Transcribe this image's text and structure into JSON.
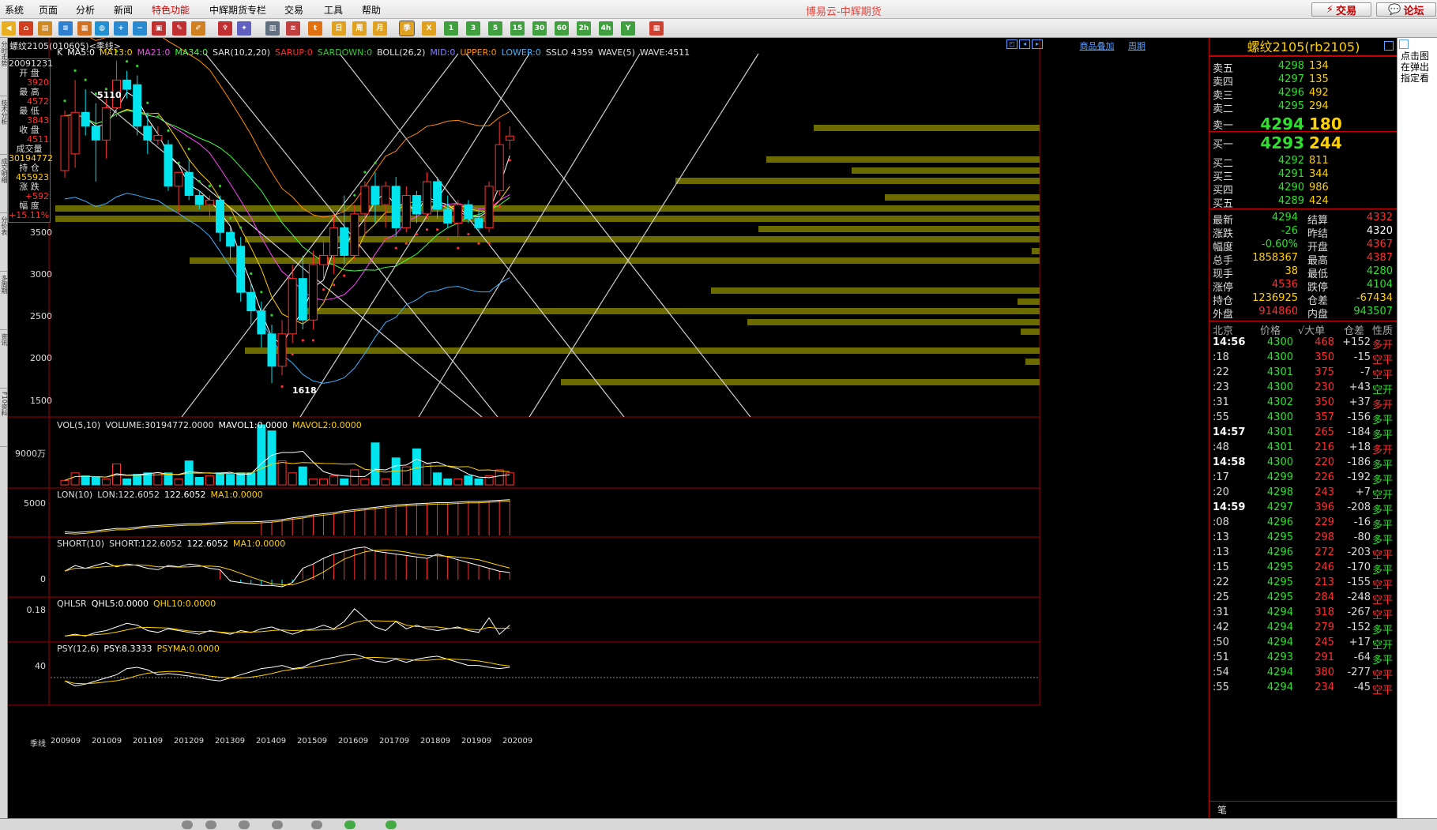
{
  "menu": {
    "items": [
      {
        "label": "系统",
        "special": false
      },
      {
        "label": "页面",
        "special": false
      },
      {
        "label": "分析",
        "special": false
      },
      {
        "label": "新闻",
        "special": false
      },
      {
        "label": "特色功能",
        "special": true
      },
      {
        "label": "中辉期货专栏",
        "special": false
      },
      {
        "label": "交易",
        "special": false
      },
      {
        "label": "工具",
        "special": false
      },
      {
        "label": "帮助",
        "special": false
      }
    ],
    "app_title": "博易云-中辉期货",
    "trade_button": "交易",
    "forum_button": "论坛"
  },
  "toolbar": {
    "period_labels": [
      "日",
      "周",
      "月",
      "季",
      "X",
      "1",
      "3",
      "5",
      "15",
      "30",
      "60",
      "2h",
      "4h",
      "Y"
    ]
  },
  "sidebar": {
    "tabs": [
      "分时走势",
      "技术分析",
      "成交明细",
      "分价表",
      "多周期",
      "资讯",
      "F10资料"
    ]
  },
  "chart": {
    "title": "螺纹2105(010605)<季线>",
    "top_links": [
      "商品叠加",
      "周期"
    ],
    "main_indicators": [
      {
        "text": "K",
        "color": "#e0e0e0"
      },
      {
        "text": "MA5:0",
        "color": "#ffffff"
      },
      {
        "text": "MA13:0",
        "color": "#ffd000"
      },
      {
        "text": "MA21:0",
        "color": "#ff44ff"
      },
      {
        "text": "MA34:0",
        "color": "#44ff44"
      },
      {
        "text": "SAR(10,2,20)",
        "color": "#e0e0e0"
      },
      {
        "text": "SARUP:0",
        "color": "#ff3030"
      },
      {
        "text": "SARDOWN:0",
        "color": "#30d030"
      },
      {
        "text": "BOLL(26,2)",
        "color": "#e0e0e0"
      },
      {
        "text": "MID:0",
        "color": "#8080ff"
      },
      {
        "text": "UPPER:0",
        "color": "#ff8c00"
      },
      {
        "text": "LOWER:0",
        "color": "#40b0ff"
      },
      {
        "text": "SSLO 4359",
        "color": "#e0e0e0"
      },
      {
        "text": "WAVE(5)",
        "color": "#e0e0e0"
      },
      {
        "text": "WAVE:4511",
        "color": "#e0e0e0"
      }
    ],
    "infobox": [
      {
        "label": "20091231",
        "value": "",
        "color": "#ffffff"
      },
      {
        "label": "开 盘",
        "value": "3920",
        "color": "#ff3030"
      },
      {
        "label": "最 高",
        "value": "4572",
        "color": "#ff3030"
      },
      {
        "label": "最 低",
        "value": "3843",
        "color": "#ff3030"
      },
      {
        "label": "收 盘",
        "value": "4511",
        "color": "#ff3030"
      },
      {
        "label": "成交量",
        "value": "30194772",
        "color": "#ffd000"
      },
      {
        "label": "持 仓",
        "value": "455923",
        "color": "#ffd000"
      },
      {
        "label": "涨 跌",
        "value": "+592",
        "color": "#ff3030"
      },
      {
        "label": "幅 度",
        "value": "+15.11%",
        "color": "#ff3030"
      }
    ],
    "price_axis": [
      "3500",
      "3000",
      "2500",
      "2000",
      "1500"
    ],
    "annotations": {
      "high": "5110",
      "low": "1618"
    },
    "vol_panel": {
      "indicators": [
        {
          "text": "VOL(5,10)",
          "color": "#e0e0e0"
        },
        {
          "text": "VOLUME:30194772.0000",
          "color": "#e0e0e0"
        },
        {
          "text": "MAVOL1:0.0000",
          "color": "#ffffff"
        },
        {
          "text": "MAVOL2:0.0000",
          "color": "#ffd000"
        }
      ],
      "axis": "9000万"
    },
    "lon_panel": {
      "indicators": [
        {
          "text": "LON(10)",
          "color": "#e0e0e0"
        },
        {
          "text": "LON:122.6052",
          "color": "#e0e0e0"
        },
        {
          "text": "122.6052",
          "color": "#ffffff"
        },
        {
          "text": "MA1:0.0000",
          "color": "#ffd000"
        }
      ],
      "axis": "5000"
    },
    "short_panel": {
      "indicators": [
        {
          "text": "SHORT(10)",
          "color": "#e0e0e0"
        },
        {
          "text": "SHORT:122.6052",
          "color": "#e0e0e0"
        },
        {
          "text": "122.6052",
          "color": "#ffffff"
        },
        {
          "text": "MA1:0.0000",
          "color": "#ffd000"
        }
      ],
      "axis": "0"
    },
    "qhlsr_panel": {
      "indicators": [
        {
          "text": "QHLSR",
          "color": "#e0e0e0"
        },
        {
          "text": "QHL5:0.0000",
          "color": "#ffffff"
        },
        {
          "text": "QHL10:0.0000",
          "color": "#ffd000"
        }
      ],
      "axis": "0.18"
    },
    "psy_panel": {
      "indicators": [
        {
          "text": "PSY(12,6)",
          "color": "#e0e0e0"
        },
        {
          "text": "PSY:8.3333",
          "color": "#ffffff"
        },
        {
          "text": "PSYMA:0.0000",
          "color": "#ffd000"
        }
      ],
      "axis": "40"
    },
    "period_label": "季线",
    "date_labels": [
      "200909",
      "201009",
      "201109",
      "201209",
      "201309",
      "201409",
      "201509",
      "201609",
      "201709",
      "201809",
      "201909",
      "202009"
    ]
  },
  "chart_data": {
    "type": "candlestick",
    "title": "螺纹2105(010605)<季线>",
    "ylim": [
      1250,
      5100
    ],
    "candles": [
      {
        "o": 3920,
        "h": 4572,
        "l": 3843,
        "c": 4511
      },
      {
        "o": 4100,
        "h": 4900,
        "l": 3950,
        "c": 4550
      },
      {
        "o": 4550,
        "h": 4800,
        "l": 4300,
        "c": 4400
      },
      {
        "o": 4400,
        "h": 4650,
        "l": 3800,
        "c": 4250
      },
      {
        "o": 4250,
        "h": 4700,
        "l": 4050,
        "c": 4600
      },
      {
        "o": 4600,
        "h": 5110,
        "l": 4500,
        "c": 4900
      },
      {
        "o": 4900,
        "h": 5000,
        "l": 4700,
        "c": 4800
      },
      {
        "o": 4850,
        "h": 4950,
        "l": 4300,
        "c": 4400
      },
      {
        "o": 4400,
        "h": 4550,
        "l": 4100,
        "c": 4250
      },
      {
        "o": 4250,
        "h": 4400,
        "l": 4200,
        "c": 4300
      },
      {
        "o": 4200,
        "h": 4250,
        "l": 3700,
        "c": 3750
      },
      {
        "o": 3750,
        "h": 3900,
        "l": 3450,
        "c": 3900
      },
      {
        "o": 3900,
        "h": 4050,
        "l": 3600,
        "c": 3650
      },
      {
        "o": 3650,
        "h": 3700,
        "l": 3500,
        "c": 3550
      },
      {
        "o": 3550,
        "h": 3650,
        "l": 3400,
        "c": 3600
      },
      {
        "o": 3600,
        "h": 3650,
        "l": 3150,
        "c": 3250
      },
      {
        "o": 3250,
        "h": 3300,
        "l": 2950,
        "c": 3100
      },
      {
        "o": 3100,
        "h": 3200,
        "l": 2500,
        "c": 2600
      },
      {
        "o": 2600,
        "h": 2700,
        "l": 2250,
        "c": 2400
      },
      {
        "o": 2400,
        "h": 2500,
        "l": 2000,
        "c": 2150
      },
      {
        "o": 2150,
        "h": 2250,
        "l": 1618,
        "c": 1800
      },
      {
        "o": 1800,
        "h": 2300,
        "l": 1700,
        "c": 2150
      },
      {
        "o": 2150,
        "h": 2900,
        "l": 2050,
        "c": 2750
      },
      {
        "o": 2750,
        "h": 3000,
        "l": 2200,
        "c": 2300
      },
      {
        "o": 2300,
        "h": 3050,
        "l": 2200,
        "c": 2900
      },
      {
        "o": 2900,
        "h": 3200,
        "l": 2750,
        "c": 3000
      },
      {
        "o": 3000,
        "h": 3450,
        "l": 2800,
        "c": 3300
      },
      {
        "o": 3300,
        "h": 3650,
        "l": 2900,
        "c": 3000
      },
      {
        "o": 3000,
        "h": 3550,
        "l": 2950,
        "c": 3450
      },
      {
        "o": 3450,
        "h": 3800,
        "l": 3200,
        "c": 3750
      },
      {
        "o": 3750,
        "h": 3900,
        "l": 3350,
        "c": 3550
      },
      {
        "o": 3550,
        "h": 3800,
        "l": 3300,
        "c": 3750
      },
      {
        "o": 3750,
        "h": 3850,
        "l": 3200,
        "c": 3300
      },
      {
        "o": 3300,
        "h": 3750,
        "l": 3250,
        "c": 3650
      },
      {
        "o": 3650,
        "h": 3700,
        "l": 3350,
        "c": 3450
      },
      {
        "o": 3450,
        "h": 3900,
        "l": 3400,
        "c": 3800
      },
      {
        "o": 3800,
        "h": 3850,
        "l": 3400,
        "c": 3500
      },
      {
        "o": 3500,
        "h": 3650,
        "l": 3300,
        "c": 3350
      },
      {
        "o": 3350,
        "h": 3600,
        "l": 3200,
        "c": 3550
      },
      {
        "o": 3550,
        "h": 3600,
        "l": 3350,
        "c": 3400
      },
      {
        "o": 3400,
        "h": 3500,
        "l": 3250,
        "c": 3300
      },
      {
        "o": 3300,
        "h": 3800,
        "l": 3250,
        "c": 3750
      },
      {
        "o": 3700,
        "h": 4450,
        "l": 3650,
        "c": 4200
      },
      {
        "o": 4250,
        "h": 4400,
        "l": 4150,
        "c": 4294
      }
    ],
    "volume": [
      15,
      40,
      30,
      25,
      20,
      70,
      20,
      35,
      40,
      40,
      40,
      20,
      80,
      25,
      30,
      40,
      35,
      40,
      40,
      200,
      180,
      80,
      40,
      60,
      20,
      20,
      30,
      20,
      50,
      20,
      140,
      20,
      90,
      60,
      120,
      70,
      40,
      20,
      20,
      30,
      20,
      30,
      50,
      40
    ],
    "lon": [
      2300,
      2250,
      2300,
      2400,
      2500,
      2600,
      2600,
      2700,
      2800,
      2850,
      2900,
      2950,
      3000,
      3000,
      3050,
      3100,
      3150,
      3150,
      3150,
      3200,
      3250,
      3350,
      3500,
      3600,
      3750,
      3850,
      3950,
      4100,
      4200,
      4300,
      4400,
      4500,
      4600,
      4650,
      4700,
      4750,
      4800,
      4800,
      4850,
      4900,
      4900,
      4950,
      5000,
      5050
    ],
    "short": [
      60,
      100,
      80,
      100,
      120,
      90,
      110,
      100,
      80,
      70,
      100,
      90,
      110,
      100,
      80,
      70,
      -10,
      -20,
      -30,
      -40,
      -40,
      -50,
      -20,
      80,
      110,
      150,
      180,
      200,
      220,
      230,
      200,
      190,
      180,
      170,
      160,
      150,
      180,
      160,
      140,
      120,
      100,
      80,
      60,
      50
    ],
    "qhl5": [
      0.02,
      0.03,
      0.02,
      0.04,
      0.05,
      0.07,
      0.09,
      0.08,
      0.05,
      0.04,
      0.06,
      0.05,
      0.04,
      0.03,
      0.05,
      0.04,
      0.03,
      0.05,
      0.04,
      0.06,
      0.07,
      0.05,
      0.03,
      0.05,
      0.06,
      0.08,
      0.06,
      0.1,
      0.17,
      0.12,
      0.07,
      0.05,
      0.1,
      0.06,
      0.08,
      0.06,
      0.05,
      0.06,
      0.07,
      0.05,
      0.04,
      0.12,
      0.03,
      0.08
    ],
    "psy": [
      20,
      12,
      15,
      20,
      25,
      30,
      40,
      42,
      38,
      30,
      32,
      30,
      28,
      25,
      22,
      20,
      25,
      30,
      35,
      40,
      42,
      45,
      40,
      42,
      50,
      55,
      58,
      62,
      63,
      58,
      52,
      50,
      55,
      50,
      55,
      58,
      60,
      55,
      50,
      45,
      45,
      42,
      40,
      42
    ]
  },
  "quote": {
    "title": "螺纹2105(rb2105)",
    "asks": [
      {
        "label": "卖五",
        "price": "4298",
        "vol": "134"
      },
      {
        "label": "卖四",
        "price": "4297",
        "vol": "135"
      },
      {
        "label": "卖三",
        "price": "4296",
        "vol": "492"
      },
      {
        "label": "卖二",
        "price": "4295",
        "vol": "294"
      },
      {
        "label": "卖一",
        "price": "4294",
        "vol": "180"
      }
    ],
    "bids": [
      {
        "label": "买一",
        "price": "4293",
        "vol": "244"
      },
      {
        "label": "买二",
        "price": "4292",
        "vol": "811"
      },
      {
        "label": "买三",
        "price": "4291",
        "vol": "344"
      },
      {
        "label": "买四",
        "price": "4290",
        "vol": "986"
      },
      {
        "label": "买五",
        "price": "4289",
        "vol": "424"
      }
    ],
    "stats": [
      {
        "l1": "最新",
        "v1": "4294",
        "c1": "#2ee02e",
        "l2": "结算",
        "v2": "4332",
        "c2": "#ff3030"
      },
      {
        "l1": "涨跌",
        "v1": "-26",
        "c1": "#2ee02e",
        "l2": "昨结",
        "v2": "4320",
        "c2": "#ffffff"
      },
      {
        "l1": "幅度",
        "v1": "-0.60%",
        "c1": "#2ee02e",
        "l2": "开盘",
        "v2": "4367",
        "c2": "#ff3030"
      },
      {
        "l1": "总手",
        "v1": "1858367",
        "c1": "#ffd000",
        "l2": "最高",
        "v2": "4387",
        "c2": "#ff3030"
      },
      {
        "l1": "现手",
        "v1": "38",
        "c1": "#ffd000",
        "l2": "最低",
        "v2": "4280",
        "c2": "#2ee02e"
      },
      {
        "l1": "涨停",
        "v1": "4536",
        "c1": "#ff3030",
        "l2": "跌停",
        "v2": "4104",
        "c2": "#2ee02e"
      },
      {
        "l1": "持仓",
        "v1": "1236925",
        "c1": "#ffd000",
        "l2": "仓差",
        "v2": "-67434",
        "c2": "#ffd000"
      },
      {
        "l1": "外盘",
        "v1": "914860",
        "c1": "#ff3030",
        "l2": "内盘",
        "v2": "943507",
        "c2": "#2ee02e"
      }
    ],
    "tick_header": {
      "time": "北京",
      "price": "价格",
      "vol": "√大单",
      "diff": "仓差",
      "nature": "性质"
    },
    "ticks": [
      {
        "t": "14:56",
        "major": true,
        "p": "4300",
        "v": "468",
        "d": "+152",
        "n": "多开",
        "nc": "#ff3030"
      },
      {
        "t": ":18",
        "major": false,
        "p": "4300",
        "v": "350",
        "d": "-15",
        "n": "空平",
        "nc": "#ff3030"
      },
      {
        "t": ":22",
        "major": false,
        "p": "4301",
        "v": "375",
        "d": "-7",
        "n": "空平",
        "nc": "#ff3030"
      },
      {
        "t": ":23",
        "major": false,
        "p": "4300",
        "v": "230",
        "d": "+43",
        "n": "空开",
        "nc": "#2ee02e"
      },
      {
        "t": ":31",
        "major": false,
        "p": "4302",
        "v": "350",
        "d": "+37",
        "n": "多开",
        "nc": "#ff3030"
      },
      {
        "t": ":55",
        "major": false,
        "p": "4300",
        "v": "357",
        "d": "-156",
        "n": "多平",
        "nc": "#2ee02e"
      },
      {
        "t": "14:57",
        "major": true,
        "p": "4301",
        "v": "265",
        "d": "-184",
        "n": "多平",
        "nc": "#2ee02e"
      },
      {
        "t": ":48",
        "major": false,
        "p": "4301",
        "v": "216",
        "d": "+18",
        "n": "多开",
        "nc": "#ff3030"
      },
      {
        "t": "14:58",
        "major": true,
        "p": "4300",
        "v": "220",
        "d": "-186",
        "n": "多平",
        "nc": "#2ee02e"
      },
      {
        "t": ":17",
        "major": false,
        "p": "4299",
        "v": "226",
        "d": "-192",
        "n": "多平",
        "nc": "#2ee02e"
      },
      {
        "t": ":20",
        "major": false,
        "p": "4298",
        "v": "243",
        "d": "+7",
        "n": "空开",
        "nc": "#2ee02e"
      },
      {
        "t": "14:59",
        "major": true,
        "p": "4297",
        "v": "396",
        "d": "-208",
        "n": "多平",
        "nc": "#2ee02e"
      },
      {
        "t": ":08",
        "major": false,
        "p": "4296",
        "v": "229",
        "d": "-16",
        "n": "多平",
        "nc": "#2ee02e"
      },
      {
        "t": ":13",
        "major": false,
        "p": "4295",
        "v": "298",
        "d": "-80",
        "n": "多平",
        "nc": "#2ee02e"
      },
      {
        "t": ":13",
        "major": false,
        "p": "4296",
        "v": "272",
        "d": "-203",
        "n": "空平",
        "nc": "#ff3030"
      },
      {
        "t": ":15",
        "major": false,
        "p": "4295",
        "v": "246",
        "d": "-170",
        "n": "多平",
        "nc": "#2ee02e"
      },
      {
        "t": ":22",
        "major": false,
        "p": "4295",
        "v": "213",
        "d": "-155",
        "n": "空平",
        "nc": "#ff3030"
      },
      {
        "t": ":25",
        "major": false,
        "p": "4295",
        "v": "284",
        "d": "-248",
        "n": "空平",
        "nc": "#ff3030"
      },
      {
        "t": ":31",
        "major": false,
        "p": "4294",
        "v": "318",
        "d": "-267",
        "n": "空平",
        "nc": "#ff3030"
      },
      {
        "t": ":42",
        "major": false,
        "p": "4294",
        "v": "279",
        "d": "-152",
        "n": "多平",
        "nc": "#2ee02e"
      },
      {
        "t": ":50",
        "major": false,
        "p": "4294",
        "v": "245",
        "d": "+17",
        "n": "空开",
        "nc": "#2ee02e"
      },
      {
        "t": ":51",
        "major": false,
        "p": "4293",
        "v": "291",
        "d": "-64",
        "n": "多平",
        "nc": "#2ee02e"
      },
      {
        "t": ":54",
        "major": false,
        "p": "4294",
        "v": "380",
        "d": "-277",
        "n": "空平",
        "nc": "#ff3030"
      },
      {
        "t": ":55",
        "major": false,
        "p": "4294",
        "v": "234",
        "d": "-45",
        "n": "空平",
        "nc": "#ff3030"
      }
    ],
    "footer_label": "笔"
  },
  "right_panel": {
    "note": "点击图在弹出指定看"
  }
}
